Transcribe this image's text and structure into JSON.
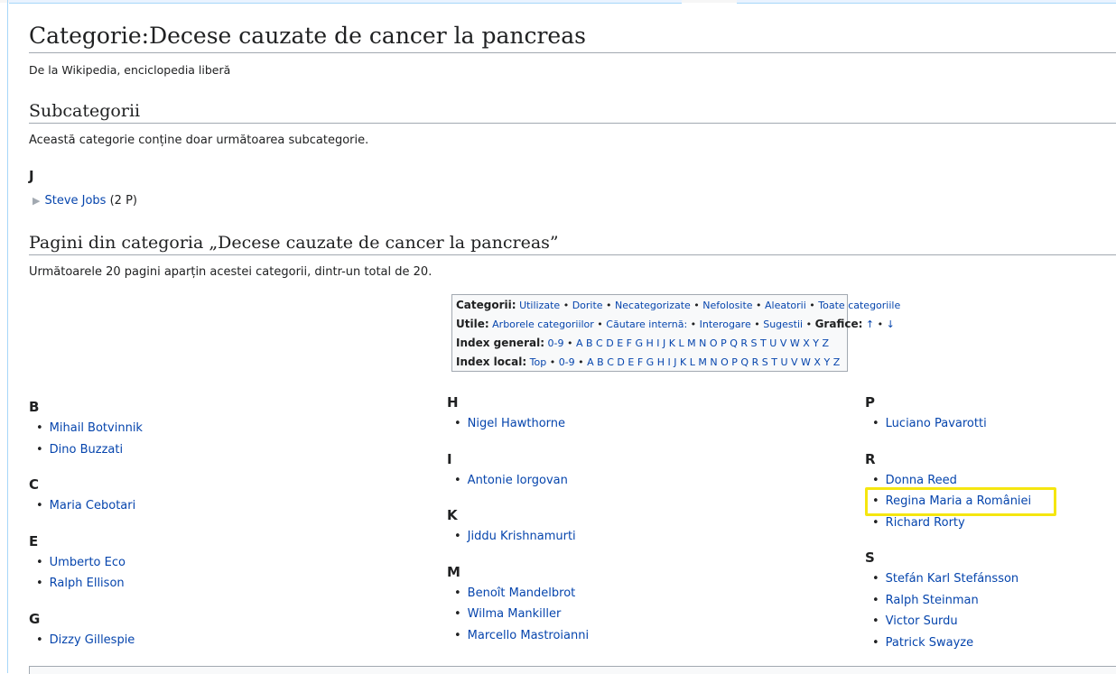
{
  "title": "Categorie:Decese cauzate de cancer la pancreas",
  "tagline": "De la Wikipedia, enciclopedia liberă",
  "subcategories": {
    "heading": "Subcategorii",
    "intro": "Această categorie conține doar următoarea subcategorie.",
    "letter": "J",
    "item": {
      "label": "Steve Jobs",
      "count": "(2 P)"
    }
  },
  "pages": {
    "heading": "Pagini din categoria „Decese cauzate de cancer la pancreas”",
    "intro": "Următoarele 20 pagini aparțin acestei categorii, dintr-un total de 20."
  },
  "index_box": {
    "row1": {
      "label": "Categorii:",
      "links": [
        "Utilizate",
        "Dorite",
        "Necategorizate",
        "Nefolosite",
        "Aleatorii",
        "Toate categoriile"
      ]
    },
    "row2": {
      "label": "Utile:",
      "links": [
        "Arborele categoriilor",
        "Căutare internă:",
        "Interogare",
        "Sugestii"
      ],
      "label2": "Grafice:",
      "arrows": [
        "↑",
        "↓"
      ]
    },
    "row3": {
      "label": "Index general:",
      "links": [
        "0-9",
        "A",
        "B",
        "C",
        "D",
        "E",
        "F",
        "G",
        "H",
        "I",
        "J",
        "K",
        "L",
        "M",
        "N",
        "O",
        "P",
        "Q",
        "R",
        "S",
        "T",
        "U",
        "V",
        "W",
        "X",
        "Y",
        "Z"
      ]
    },
    "row4": {
      "label": "Index local:",
      "links": [
        "Top",
        "0-9",
        "A",
        "B",
        "C",
        "D",
        "E",
        "F",
        "G",
        "H",
        "I",
        "J",
        "K",
        "L",
        "M",
        "N",
        "O",
        "P",
        "Q",
        "R",
        "S",
        "T",
        "U",
        "V",
        "W",
        "X",
        "Y",
        "Z"
      ]
    }
  },
  "columns": [
    [
      {
        "letter": "B",
        "items": [
          "Mihail Botvinnik",
          "Dino Buzzati"
        ]
      },
      {
        "letter": "C",
        "items": [
          "Maria Cebotari"
        ]
      },
      {
        "letter": "E",
        "items": [
          "Umberto Eco",
          "Ralph Ellison"
        ]
      },
      {
        "letter": "G",
        "items": [
          "Dizzy Gillespie"
        ]
      }
    ],
    [
      {
        "letter": "H",
        "items": [
          "Nigel Hawthorne"
        ]
      },
      {
        "letter": "I",
        "items": [
          "Antonie Iorgovan"
        ]
      },
      {
        "letter": "K",
        "items": [
          "Jiddu Krishnamurti"
        ]
      },
      {
        "letter": "M",
        "items": [
          "Benoît Mandelbrot",
          "Wilma Mankiller",
          "Marcello Mastroianni"
        ]
      }
    ],
    [
      {
        "letter": "P",
        "items": [
          "Luciano Pavarotti"
        ]
      },
      {
        "letter": "R",
        "items": [
          "Donna Reed",
          "Regina Maria a României",
          "Richard Rorty"
        ]
      },
      {
        "letter": "S",
        "items": [
          "Stefán Karl Stefánsson",
          "Ralph Steinman",
          "Victor Surdu",
          "Patrick Swayze"
        ]
      }
    ]
  ],
  "colors": {
    "link": "#0645ad",
    "highlight": "#f5e60f",
    "border": "#a2a9b1"
  }
}
